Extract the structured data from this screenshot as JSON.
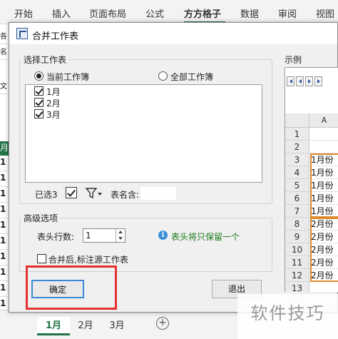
{
  "ribbon": {
    "tabs": [
      {
        "label": "开始"
      },
      {
        "label": "插入"
      },
      {
        "label": "页面布局"
      },
      {
        "label": "公式"
      },
      {
        "label": "方方格子",
        "active": true
      },
      {
        "label": "数据"
      },
      {
        "label": "审阅"
      },
      {
        "label": "视图"
      }
    ],
    "accent_color": "#217346"
  },
  "background": {
    "row_label_green": "月",
    "row_labels": [
      "1",
      "1",
      "1",
      "1",
      "1",
      "1",
      "1",
      "1",
      "1",
      "1"
    ],
    "left_edge_labels": [
      "各",
      "名",
      "文"
    ]
  },
  "dialog": {
    "title": "合并工作表",
    "select_group": {
      "label": "选择工作表",
      "radio_current": "当前工作簿",
      "radio_all": "全部工作簿",
      "selected": "当前工作簿",
      "sheets": [
        {
          "name": "1月",
          "checked": true
        },
        {
          "name": "2月",
          "checked": true
        },
        {
          "name": "3月",
          "checked": true
        }
      ],
      "selected_count_label": "已选3",
      "sheet_name_label": "表名含:",
      "sheet_name_value": ""
    },
    "advanced_group": {
      "label": "高级选项",
      "header_rows_label": "表头行数:",
      "header_rows_value": "1",
      "hint": "表头将只保留一个",
      "mark_source_label": "合并后,标注源工作表",
      "mark_source_checked": false
    },
    "ok_label": "确定",
    "exit_label": "退出",
    "preview": {
      "label": "示例",
      "column_header": "A",
      "rows": [
        {
          "num": "1",
          "value": ""
        },
        {
          "num": "2",
          "value": ""
        },
        {
          "num": "3",
          "value": "1月份"
        },
        {
          "num": "4",
          "value": "1月份"
        },
        {
          "num": "5",
          "value": "1月份"
        },
        {
          "num": "6",
          "value": "1月份"
        },
        {
          "num": "7",
          "value": "1月份"
        },
        {
          "num": "8",
          "value": "2月份"
        },
        {
          "num": "9",
          "value": "2月份"
        },
        {
          "num": "10",
          "value": "2月份"
        },
        {
          "num": "11",
          "value": "2月份"
        },
        {
          "num": "12",
          "value": "2月份"
        },
        {
          "num": "13",
          "value": ""
        }
      ],
      "highlight_color": "#e08a2e"
    }
  },
  "sheet_tabs": [
    {
      "label": "1月",
      "active": true
    },
    {
      "label": "2月"
    },
    {
      "label": "3月"
    }
  ],
  "add_sheet_glyph": "+",
  "watermark": "软件技巧",
  "highlight_color": "#e5312d"
}
